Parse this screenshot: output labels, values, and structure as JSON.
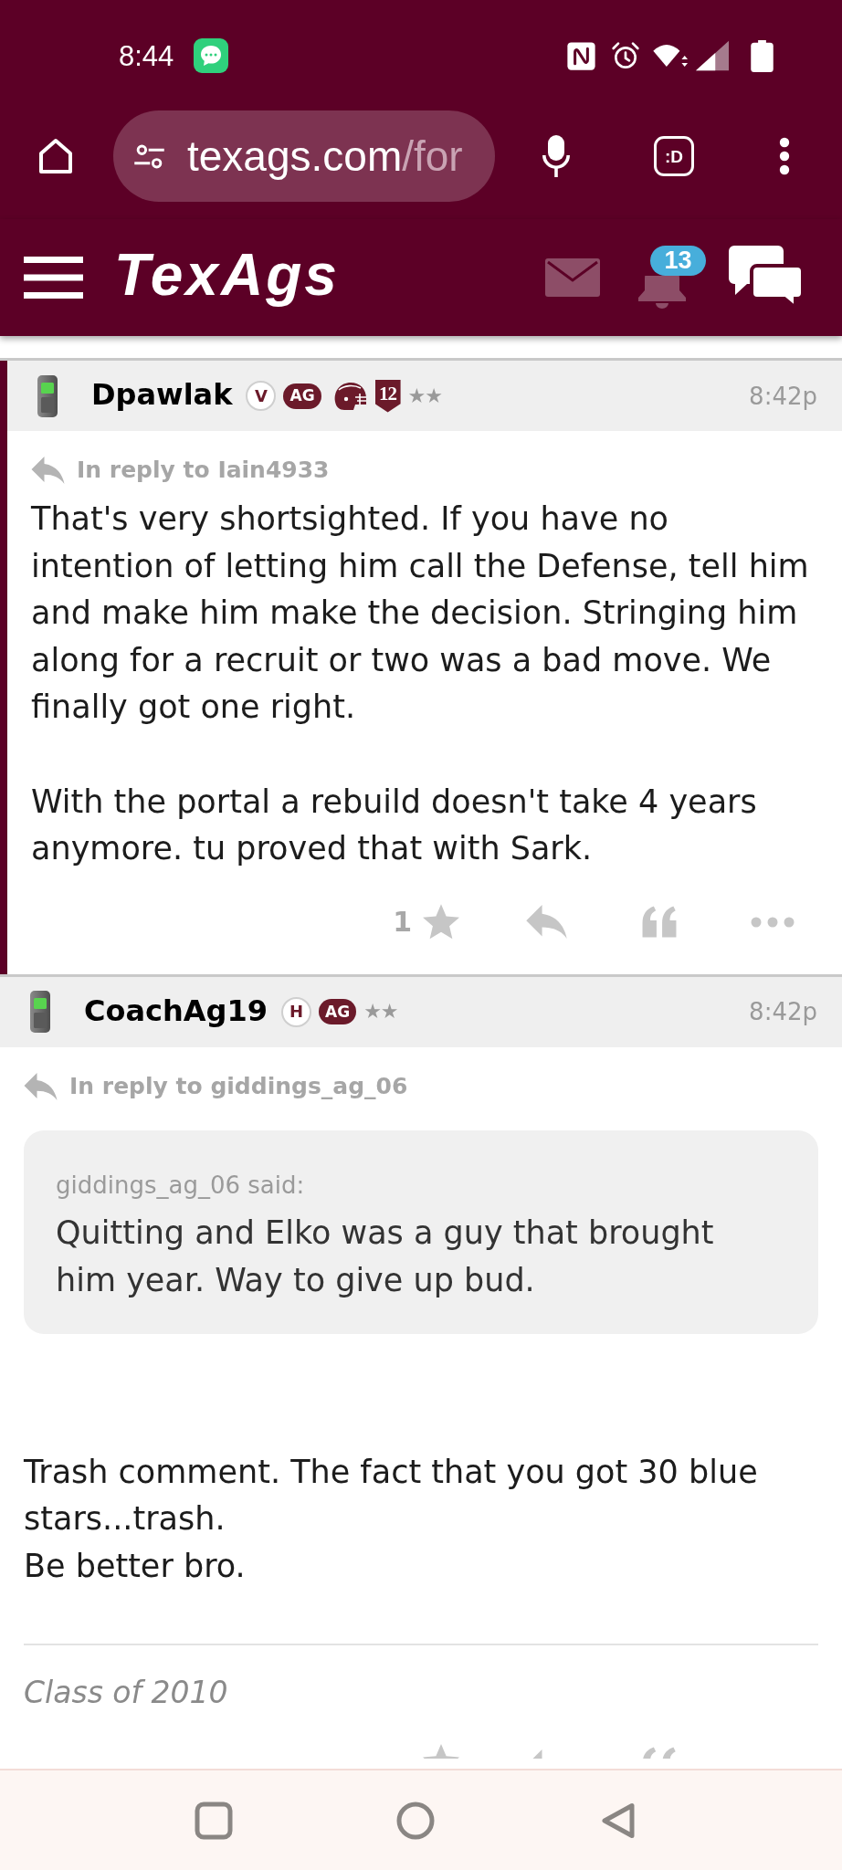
{
  "status_bar": {
    "time": "8:44"
  },
  "browser": {
    "url_host": "texags.com",
    "url_path": "/for",
    "extension_label": ":D"
  },
  "site_header": {
    "logo": "TexAgs",
    "notification_count": "13"
  },
  "posts": [
    {
      "author": "Dpawlak",
      "highlighted": true,
      "badges": [
        {
          "kind": "circle",
          "label": "V"
        },
        {
          "kind": "pill",
          "label": "AG"
        },
        {
          "kind": "helmet"
        },
        {
          "kind": "shield",
          "label": "12"
        }
      ],
      "rank_stars": "★★",
      "time": "8:42p",
      "reply_to": "In reply to Iain4933",
      "text": "That's very shortsighted. If you have no intention of letting him call the Defense, tell him and make him make the decision. Stringing him along for a recruit or two was a bad move. We finally got one right.\n\nWith the portal a rebuild doesn't take 4 years anymore. tu proved that with Sark.",
      "star_count": "1",
      "actions_cut": false
    },
    {
      "author": "CoachAg19",
      "highlighted": false,
      "badges": [
        {
          "kind": "circle",
          "label": "H"
        },
        {
          "kind": "pill",
          "label": "AG"
        }
      ],
      "rank_stars": "★★",
      "time": "8:42p",
      "reply_to": "In reply to giddings_ag_06",
      "quote": {
        "attribution": "giddings_ag_06 said:",
        "text": "Quitting and Elko was a guy that brought him year. Way to give up bud."
      },
      "text": "Trash comment. The fact that you got 30 blue stars...trash.\nBe better bro.",
      "signature": "Class of 2010",
      "actions_cut": true
    }
  ]
}
